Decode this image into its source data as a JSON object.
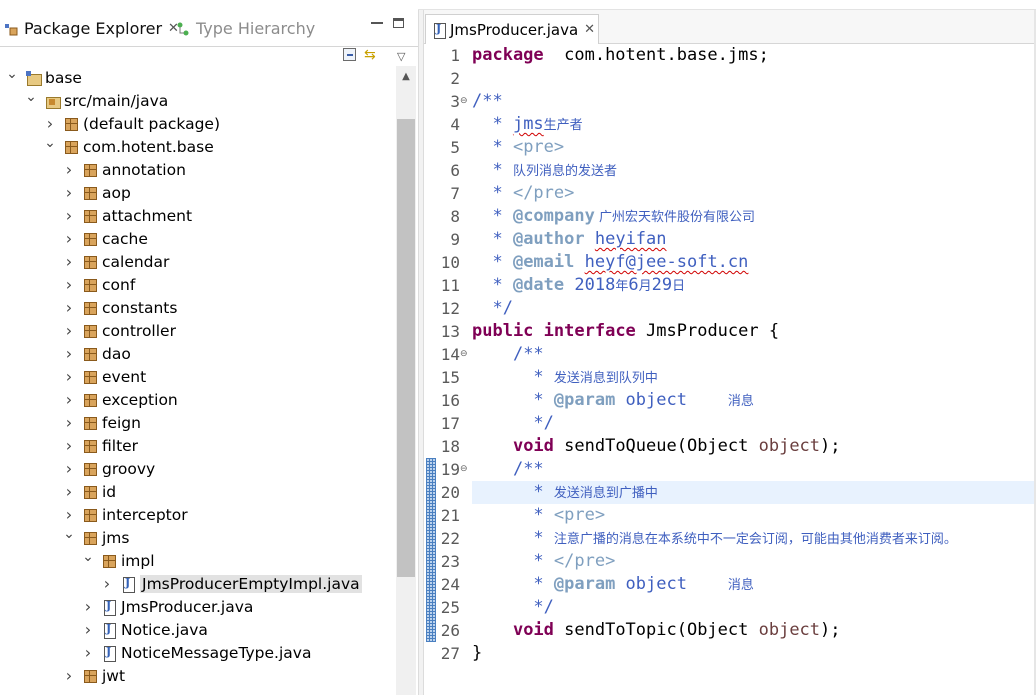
{
  "left_panel": {
    "tabs": [
      {
        "label": "Package Explorer",
        "active": true,
        "close": "✕"
      },
      {
        "label": "Type Hierarchy",
        "active": false
      }
    ],
    "tree": [
      {
        "label": "base",
        "indent": 0,
        "icon": "project-icon",
        "expanded": true
      },
      {
        "label": "src/main/java",
        "indent": 1,
        "icon": "source-folder-icon",
        "expanded": true
      },
      {
        "label": "(default package)",
        "indent": 2,
        "icon": "package-icon",
        "expanded": false
      },
      {
        "label": "com.hotent.base",
        "indent": 2,
        "icon": "package-icon",
        "expanded": true
      },
      {
        "label": "annotation",
        "indent": 3,
        "icon": "package-icon",
        "expanded": false
      },
      {
        "label": "aop",
        "indent": 3,
        "icon": "package-icon",
        "expanded": false
      },
      {
        "label": "attachment",
        "indent": 3,
        "icon": "package-icon",
        "expanded": false
      },
      {
        "label": "cache",
        "indent": 3,
        "icon": "package-icon",
        "expanded": false
      },
      {
        "label": "calendar",
        "indent": 3,
        "icon": "package-icon",
        "expanded": false
      },
      {
        "label": "conf",
        "indent": 3,
        "icon": "package-icon",
        "expanded": false
      },
      {
        "label": "constants",
        "indent": 3,
        "icon": "package-icon",
        "expanded": false
      },
      {
        "label": "controller",
        "indent": 3,
        "icon": "package-icon",
        "expanded": false
      },
      {
        "label": "dao",
        "indent": 3,
        "icon": "package-icon",
        "expanded": false
      },
      {
        "label": "event",
        "indent": 3,
        "icon": "package-icon",
        "expanded": false
      },
      {
        "label": "exception",
        "indent": 3,
        "icon": "package-icon",
        "expanded": false
      },
      {
        "label": "feign",
        "indent": 3,
        "icon": "package-icon",
        "expanded": false
      },
      {
        "label": "filter",
        "indent": 3,
        "icon": "package-icon",
        "expanded": false
      },
      {
        "label": "groovy",
        "indent": 3,
        "icon": "package-icon",
        "expanded": false
      },
      {
        "label": "id",
        "indent": 3,
        "icon": "package-icon",
        "expanded": false
      },
      {
        "label": "interceptor",
        "indent": 3,
        "icon": "package-icon",
        "expanded": false
      },
      {
        "label": "jms",
        "indent": 3,
        "icon": "package-icon",
        "expanded": true
      },
      {
        "label": "impl",
        "indent": 4,
        "icon": "package-icon",
        "expanded": true
      },
      {
        "label": "JmsProducerEmptyImpl.java",
        "indent": 5,
        "icon": "java-file-icon",
        "expanded": false,
        "selected": true
      },
      {
        "label": "JmsProducer.java",
        "indent": 4,
        "icon": "java-file-icon",
        "expanded": false
      },
      {
        "label": "Notice.java",
        "indent": 4,
        "icon": "java-file-icon",
        "expanded": false
      },
      {
        "label": "NoticeMessageType.java",
        "indent": 4,
        "icon": "java-file-icon",
        "expanded": false
      },
      {
        "label": "jwt",
        "indent": 3,
        "icon": "package-icon",
        "expanded": false
      }
    ]
  },
  "editor": {
    "tab": {
      "label": "JmsProducer.java",
      "close": "✕"
    },
    "current_line": 20,
    "lines": [
      {
        "n": "1",
        "fold": false,
        "segs": [
          [
            "kw",
            "package"
          ],
          [
            "",
            "  com.hotent.base.jms;"
          ]
        ]
      },
      {
        "n": "2",
        "fold": false,
        "segs": []
      },
      {
        "n": "3",
        "fold": true,
        "segs": [
          [
            "jd",
            "/**"
          ]
        ]
      },
      {
        "n": "4",
        "fold": false,
        "segs": [
          [
            "jd",
            "  * "
          ],
          [
            "jd sq",
            "jms"
          ],
          [
            "jd zh",
            "生产者"
          ]
        ]
      },
      {
        "n": "5",
        "fold": false,
        "segs": [
          [
            "jd",
            "  * "
          ],
          [
            "jt-n",
            "<pre>"
          ]
        ]
      },
      {
        "n": "6",
        "fold": false,
        "segs": [
          [
            "jd",
            "  * "
          ],
          [
            "jd zh",
            "队列消息的发送者"
          ]
        ]
      },
      {
        "n": "7",
        "fold": false,
        "segs": [
          [
            "jd",
            "  * "
          ],
          [
            "jt-n",
            "</pre>"
          ]
        ]
      },
      {
        "n": "8",
        "fold": false,
        "segs": [
          [
            "jd",
            "  * "
          ],
          [
            "jt",
            "@company"
          ],
          [
            "jd zh",
            " 广州宏天软件股份有限公司"
          ]
        ]
      },
      {
        "n": "9",
        "fold": false,
        "segs": [
          [
            "jd",
            "  * "
          ],
          [
            "jt",
            "@author"
          ],
          [
            "jd",
            " "
          ],
          [
            "jd sq",
            "heyifan"
          ]
        ]
      },
      {
        "n": "10",
        "fold": false,
        "segs": [
          [
            "jd",
            "  * "
          ],
          [
            "jt",
            "@email"
          ],
          [
            "jd",
            " "
          ],
          [
            "jd sq",
            "heyf@jee-soft.cn"
          ]
        ]
      },
      {
        "n": "11",
        "fold": false,
        "segs": [
          [
            "jd",
            "  * "
          ],
          [
            "jt",
            "@date"
          ],
          [
            "jd",
            " 2018"
          ],
          [
            "jd zh",
            "年"
          ],
          [
            "jd",
            "6"
          ],
          [
            "jd zh",
            "月"
          ],
          [
            "jd",
            "29"
          ],
          [
            "jd zh",
            "日"
          ]
        ]
      },
      {
        "n": "12",
        "fold": false,
        "segs": [
          [
            "jd",
            "  */"
          ]
        ]
      },
      {
        "n": "13",
        "fold": false,
        "segs": [
          [
            "kw",
            "public"
          ],
          [
            "",
            " "
          ],
          [
            "kw",
            "interface"
          ],
          [
            "",
            " JmsProducer {"
          ]
        ]
      },
      {
        "n": "14",
        "fold": true,
        "segs": [
          [
            "",
            "    "
          ],
          [
            "jd",
            "/**"
          ]
        ]
      },
      {
        "n": "15",
        "fold": false,
        "segs": [
          [
            "jd",
            "      * "
          ],
          [
            "jd zh",
            "发送消息到队列中"
          ]
        ]
      },
      {
        "n": "16",
        "fold": false,
        "segs": [
          [
            "jd",
            "      * "
          ],
          [
            "jt",
            "@param"
          ],
          [
            "jd",
            " object    "
          ],
          [
            "jd zh",
            "消息"
          ]
        ]
      },
      {
        "n": "17",
        "fold": false,
        "segs": [
          [
            "jd",
            "      */"
          ]
        ]
      },
      {
        "n": "18",
        "fold": false,
        "segs": [
          [
            "",
            "    "
          ],
          [
            "kw",
            "void"
          ],
          [
            "",
            " sendToQueue(Object "
          ],
          [
            "pv",
            "object"
          ],
          [
            "",
            ");"
          ]
        ]
      },
      {
        "n": "19",
        "fold": true,
        "segs": [
          [
            "",
            "    "
          ],
          [
            "jd",
            "/**"
          ]
        ]
      },
      {
        "n": "20",
        "fold": false,
        "segs": [
          [
            "jd",
            "      * "
          ],
          [
            "jd zh",
            "发送消息到广播中"
          ]
        ]
      },
      {
        "n": "21",
        "fold": false,
        "segs": [
          [
            "jd",
            "      * "
          ],
          [
            "jt-n",
            "<pre>"
          ]
        ]
      },
      {
        "n": "22",
        "fold": false,
        "segs": [
          [
            "jd",
            "      * "
          ],
          [
            "jd zh",
            "注意广播的消息在本系统中不一定会订阅，可能由其他消费者来订阅。"
          ]
        ]
      },
      {
        "n": "23",
        "fold": false,
        "segs": [
          [
            "jd",
            "      * "
          ],
          [
            "jt-n",
            "</pre>"
          ]
        ]
      },
      {
        "n": "24",
        "fold": false,
        "segs": [
          [
            "jd",
            "      * "
          ],
          [
            "jt",
            "@param"
          ],
          [
            "jd",
            " object    "
          ],
          [
            "jd zh",
            "消息"
          ]
        ]
      },
      {
        "n": "25",
        "fold": false,
        "segs": [
          [
            "jd",
            "      */"
          ]
        ]
      },
      {
        "n": "26",
        "fold": false,
        "segs": [
          [
            "",
            "    "
          ],
          [
            "kw",
            "void"
          ],
          [
            "",
            " sendToTopic(Object "
          ],
          [
            "pv",
            "object"
          ],
          [
            "",
            ");"
          ]
        ]
      },
      {
        "n": "27",
        "fold": false,
        "segs": [
          [
            "",
            "}"
          ]
        ]
      }
    ]
  }
}
